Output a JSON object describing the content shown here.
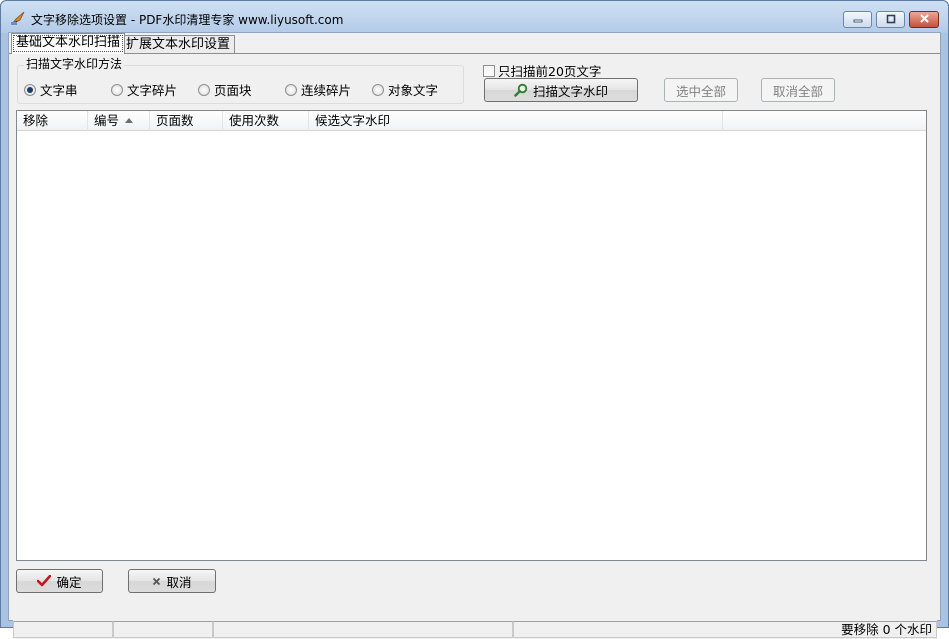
{
  "window": {
    "title": "文字移除选项设置 - PDF水印清理专家 www.liyusoft.com"
  },
  "tabs": [
    {
      "label": "基础文本水印扫描",
      "active": true
    },
    {
      "label": "扩展文本水印设置",
      "active": false
    }
  ],
  "scan_method": {
    "legend": "扫描文字水印方法",
    "options": [
      {
        "label": "文字串",
        "checked": true
      },
      {
        "label": "文字碎片",
        "checked": false
      },
      {
        "label": "页面块",
        "checked": false
      },
      {
        "label": "连续碎片",
        "checked": false
      },
      {
        "label": "对象文字",
        "checked": false
      }
    ]
  },
  "only_first_pages": {
    "label": "只扫描前20页文字",
    "checked": false
  },
  "buttons": {
    "scan": "扫描文字水印",
    "select_all": "选中全部",
    "deselect_all": "取消全部",
    "ok": "确定",
    "cancel": "取消"
  },
  "list": {
    "columns": [
      "移除",
      "编号",
      "页面数",
      "使用次数",
      "候选文字水印"
    ],
    "sorted_column": "编号",
    "rows": []
  },
  "status": {
    "summary": "要移除 0 个水印"
  },
  "colors": {
    "titlebar": "#b9cfea",
    "ok_check": "#c8141e",
    "cancel_x": "#555555",
    "scan_icon": "#2e7d2e"
  }
}
